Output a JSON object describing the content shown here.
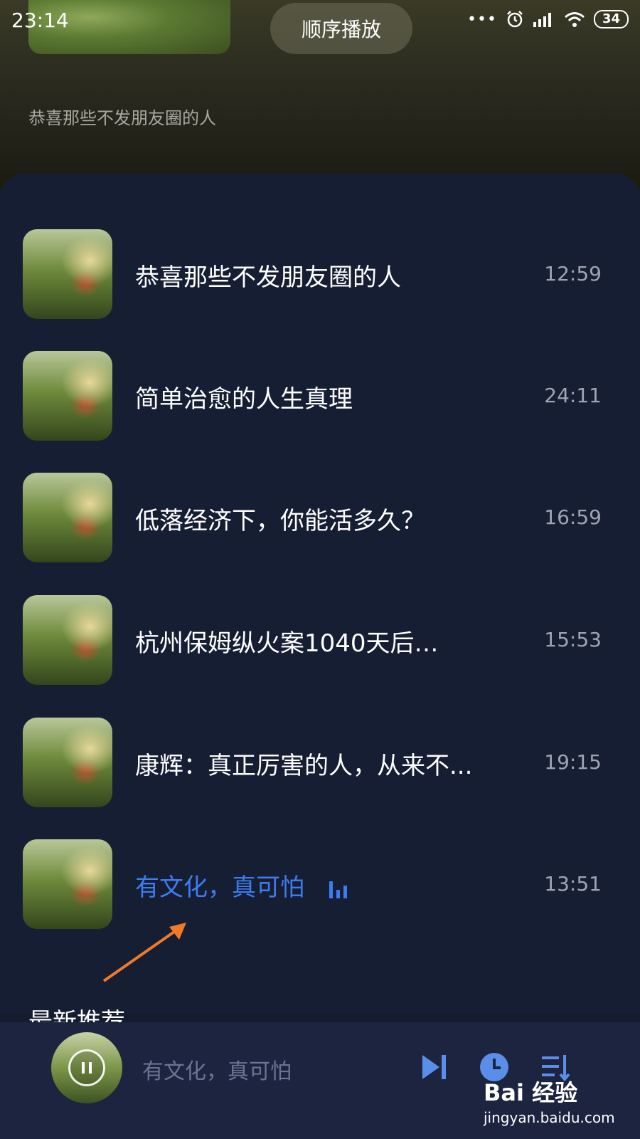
{
  "status_bar": {
    "time": "23:14",
    "dots": "•••",
    "battery": "34"
  },
  "header": {
    "play_mode": "顺序播放",
    "album_title": "恭喜那些不发朋友圈的人"
  },
  "tracks": [
    {
      "title": "恭喜那些不发朋友圈的人",
      "duration": "12:59",
      "active": false
    },
    {
      "title": "简单治愈的人生真理",
      "duration": "24:11",
      "active": false
    },
    {
      "title": "低落经济下，你能活多久？",
      "duration": "16:59",
      "active": false
    },
    {
      "title": "杭州保姆纵火案1040天后…",
      "duration": "15:53",
      "active": false
    },
    {
      "title": "康辉：真正厉害的人，从来不...",
      "duration": "19:15",
      "active": false
    },
    {
      "title": "有文化，真可怕",
      "duration": "13:51",
      "active": true
    }
  ],
  "section": {
    "label": "最新推荐"
  },
  "player": {
    "now_playing": "有文化，真可怕"
  },
  "watermark": {
    "brand": "Bai 经验",
    "url": "jingyan.baidu.com"
  },
  "colors": {
    "accent": "#3d7cf0",
    "sheet": "#161e34",
    "player_bar": "#1c2440",
    "arrow": "#f07a2a"
  },
  "icons": [
    "alarm-icon",
    "signal-icon",
    "wifi-icon",
    "next-track-icon",
    "timer-icon",
    "playlist-icon",
    "pause-icon",
    "equalizer-icon"
  ]
}
